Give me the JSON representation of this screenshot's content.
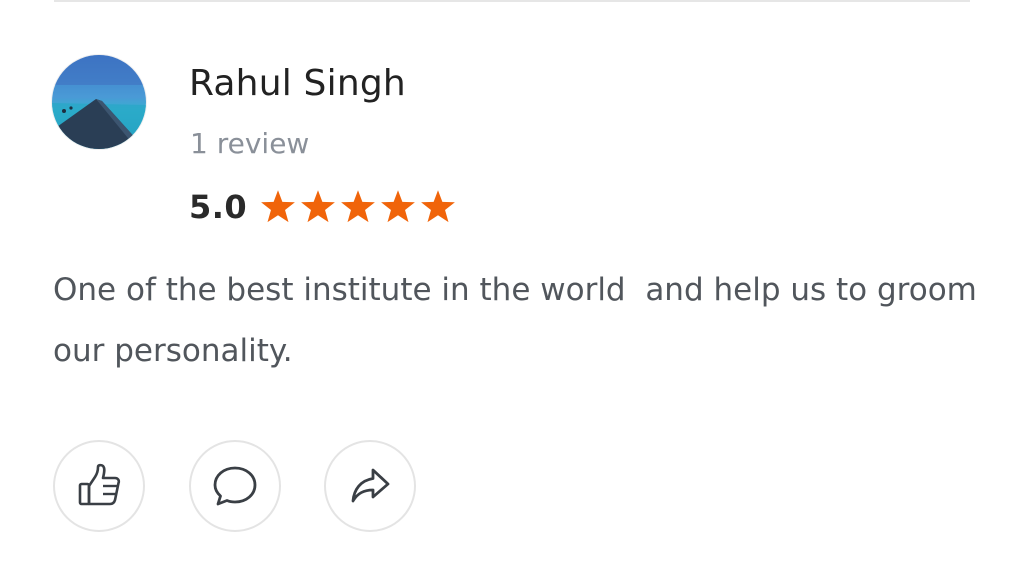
{
  "review": {
    "reviewer_name": "Rahul Singh",
    "review_count": "1 review",
    "rating_value": "5.0",
    "rating_stars": 5,
    "text": "One of the best institute in the world  and help us to groom our personality."
  },
  "actions": {
    "like_icon": "thumbs-up-icon",
    "comment_icon": "comment-bubble-icon",
    "share_icon": "share-arrow-icon"
  },
  "colors": {
    "star": "#f0640a",
    "name_text": "#222222",
    "secondary_text": "#8a9099",
    "body_text": "#51565c",
    "button_border": "#e4e4e4"
  }
}
